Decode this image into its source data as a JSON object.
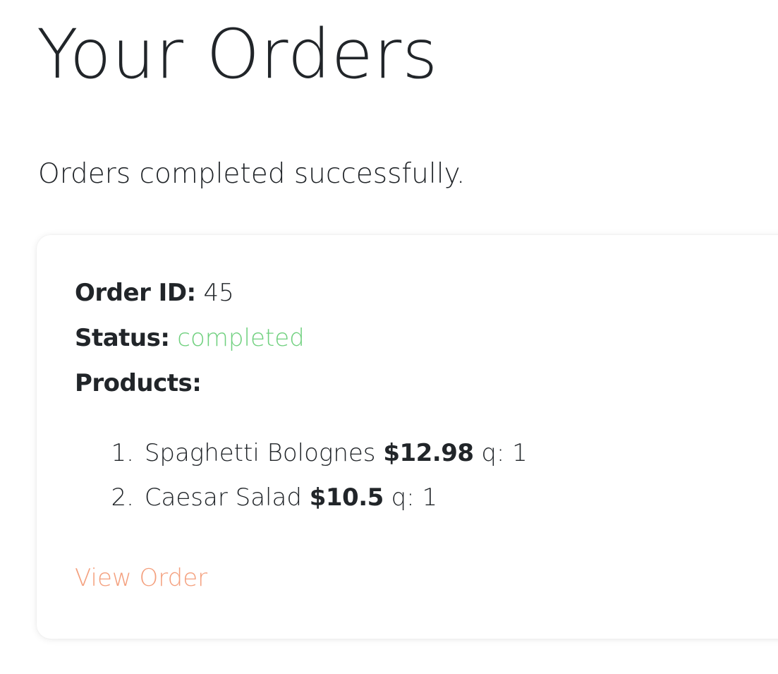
{
  "page": {
    "title": "Your Orders",
    "message": "Orders completed successfully."
  },
  "colors": {
    "status_completed": "#6fd07e",
    "link": "#f4a07e",
    "text": "#212529"
  },
  "order": {
    "id_label": "Order ID:",
    "id_value": "45",
    "status_label": "Status:",
    "status_value": "completed",
    "products_label": "Products:",
    "products": [
      {
        "number": "1.",
        "name": "Spaghetti Bolognes",
        "price": "$12.98",
        "quantity": "q: 1"
      },
      {
        "number": "2.",
        "name": "Caesar Salad",
        "price": "$10.5",
        "quantity": "q: 1"
      }
    ],
    "view_link": "View Order"
  }
}
